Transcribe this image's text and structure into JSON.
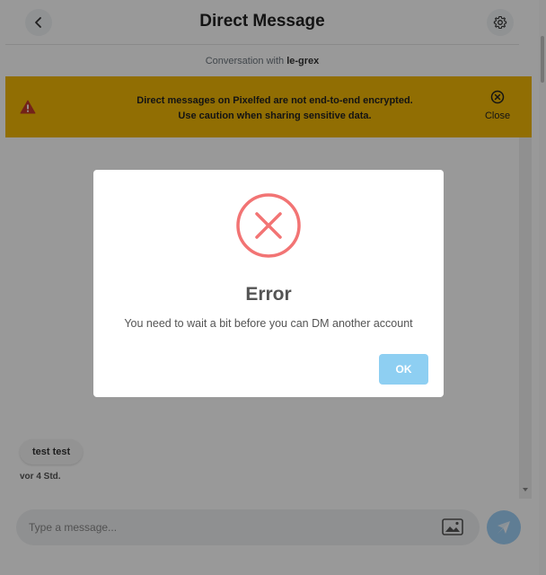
{
  "header": {
    "title": "Direct Message",
    "back_icon": "chevron-left-icon",
    "settings_icon": "gear-icon"
  },
  "subheader": {
    "prefix": "Conversation with ",
    "username": "le-grex"
  },
  "banner": {
    "line1": "Direct messages on Pixelfed are not end-to-end encrypted.",
    "line2": "Use caution when sharing sensitive data.",
    "close_label": "Close",
    "color": "#f2b705"
  },
  "messages": [
    {
      "text": "test test",
      "time": "vor 4 Std."
    }
  ],
  "composer": {
    "placeholder": "Type a message..."
  },
  "modal": {
    "title": "Error",
    "text": "You need to wait a bit before you can DM another account",
    "ok_label": "OK",
    "icon": "error-x-icon",
    "accent": "#f27474",
    "button_color": "#8ecff2"
  }
}
